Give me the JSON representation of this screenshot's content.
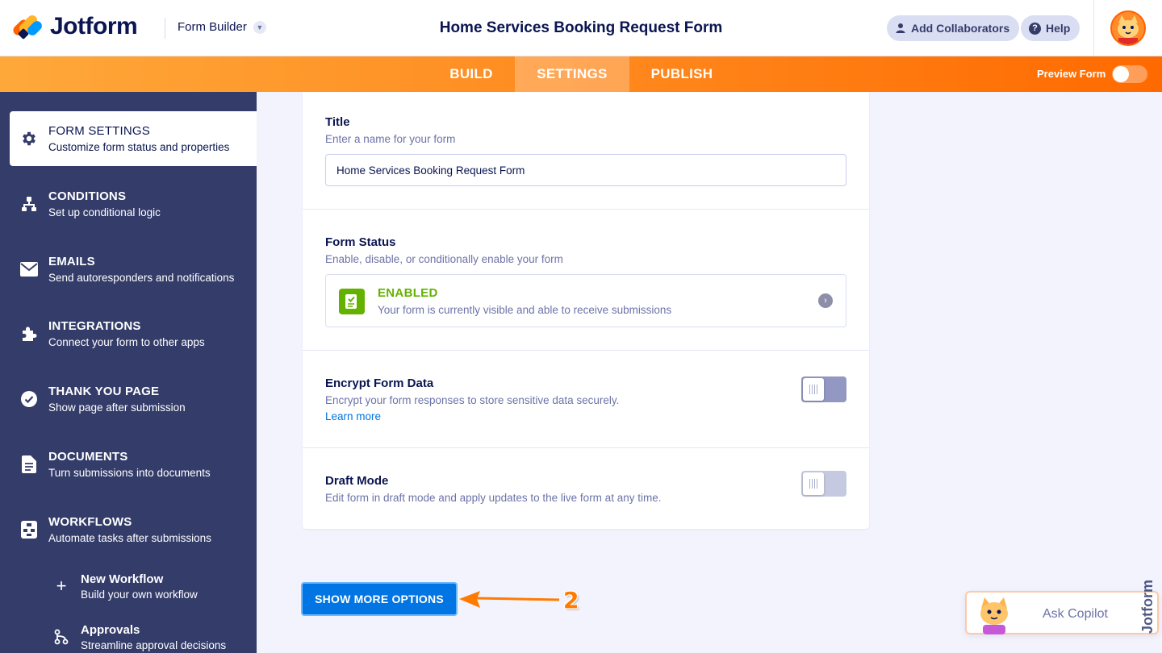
{
  "header": {
    "brand": "Jotform",
    "builder_label": "Form Builder",
    "form_title": "Home Services Booking Request Form",
    "collaborators_label": "Add Collaborators",
    "help_label": "Help"
  },
  "nav": {
    "tabs": [
      {
        "label": "BUILD",
        "active": false
      },
      {
        "label": "SETTINGS",
        "active": true
      },
      {
        "label": "PUBLISH",
        "active": false
      }
    ],
    "preview_label": "Preview Form",
    "preview_on": false
  },
  "sidebar": {
    "items": [
      {
        "title": "FORM SETTINGS",
        "subtitle": "Customize form status and properties",
        "icon": "gear-icon",
        "active": true
      },
      {
        "title": "CONDITIONS",
        "subtitle": "Set up conditional logic",
        "icon": "conditions-icon"
      },
      {
        "title": "EMAILS",
        "subtitle": "Send autoresponders and notifications",
        "icon": "envelope-icon"
      },
      {
        "title": "INTEGRATIONS",
        "subtitle": "Connect your form to other apps",
        "icon": "puzzle-icon"
      },
      {
        "title": "THANK YOU PAGE",
        "subtitle": "Show page after submission",
        "icon": "check-circle-icon"
      },
      {
        "title": "DOCUMENTS",
        "subtitle": "Turn submissions into documents",
        "icon": "document-icon"
      },
      {
        "title": "WORKFLOWS",
        "subtitle": "Automate tasks after submissions",
        "icon": "workflow-icon"
      }
    ],
    "sub_items": [
      {
        "title": "New Workflow",
        "subtitle": "Build your own workflow",
        "icon": "plus-icon"
      },
      {
        "title": "Approvals",
        "subtitle": "Streamline approval decisions",
        "icon": "approval-flow-icon"
      }
    ]
  },
  "settings": {
    "title": {
      "label": "Title",
      "description": "Enter a name for your form",
      "value": "Home Services Booking Request Form"
    },
    "status": {
      "label": "Form Status",
      "description": "Enable, disable, or conditionally enable your form",
      "state": "ENABLED",
      "state_desc": "Your form is currently visible and able to receive submissions",
      "color": "#64b200"
    },
    "encrypt": {
      "label": "Encrypt Form Data",
      "description": "Encrypt your form responses to store sensitive data securely.",
      "link": "Learn more",
      "enabled": false
    },
    "draft": {
      "label": "Draft Mode",
      "description": "Edit form in draft mode and apply updates to the live form at any time.",
      "enabled": false
    }
  },
  "actions": {
    "show_more_label": "SHOW MORE OPTIONS"
  },
  "annotation": {
    "step": "2",
    "color": "#ff7a00"
  },
  "copilot": {
    "label": "Ask Copilot"
  },
  "colors": {
    "navy": "#0a1551",
    "sidebar": "#343c6a",
    "accent_orange": "#ff6100",
    "primary_blue": "#0075e3",
    "enabled_green": "#64b200"
  }
}
